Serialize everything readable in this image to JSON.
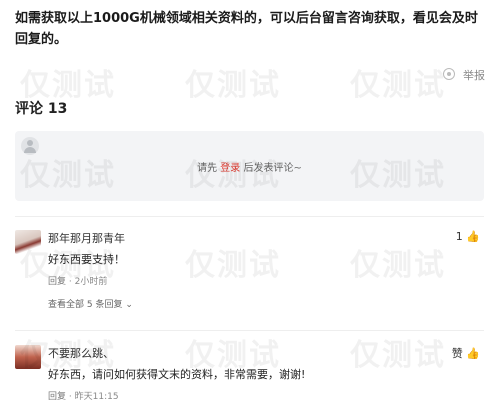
{
  "article": {
    "intro": "如需获取以上1000G机械领域相关资料的，可以后台留言咨询获取，看见会及时回复的。"
  },
  "meta": {
    "text": "举报"
  },
  "comments": {
    "title": "评论 13",
    "composer": {
      "prefix": "请先",
      "login": "登录",
      "suffix": "后发表评论~"
    },
    "items": [
      {
        "name": "那年那月那青年",
        "likes": "1",
        "body": "好东西要支持！",
        "reply": "回复",
        "time": "2小时前",
        "more": "查看全部 5 条回复"
      },
      {
        "name": "不要那么跳、",
        "likes": "赞",
        "body": "好东西，请问如何获得文末的资料，非常需要，谢谢!",
        "reply": "回复",
        "time": "昨天11:15"
      }
    ]
  },
  "watermark": "仅测试"
}
